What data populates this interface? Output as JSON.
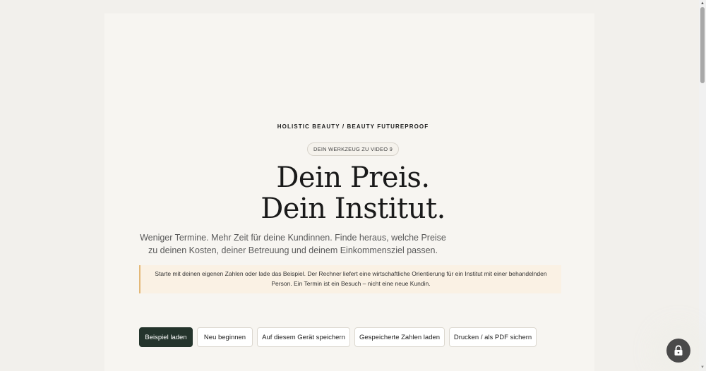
{
  "header": {
    "eyebrow": "HOLISTIC BEAUTY / BEAUTY FUTUREPROOF",
    "pill": "DEIN WERKZEUG ZU VIDEO 9",
    "headline_line1": "Dein Preis.",
    "headline_line2": "Dein Institut.",
    "intro": "Weniger Termine. Mehr Zeit für deine Kundinnen. Finde heraus, welche Preise zu deinen Kosten, deiner Betreuung und deinem Einkommensziel passen."
  },
  "notice": {
    "text": "Starte mit deinen eigenen Zahlen oder lade das Beispiel. Der Rechner liefert eine wirtschaftliche Orientierung für ein Institut mit einer behandelnden Person. Ein Termin ist ein Besuch – nicht eine neue Kundin."
  },
  "actions": {
    "load_example": "Beispiel laden",
    "restart": "Neu beginnen",
    "save_device": "Auf diesem Gerät speichern",
    "load_saved": "Gespeicherte Zahlen laden",
    "print_pdf": "Drucken / als PDF sichern"
  },
  "icons": {
    "floating": "lock-icon",
    "scroll_up": "arrow-up-icon",
    "scroll_down": "arrow-down-icon"
  },
  "colors": {
    "primary_button": "#24342c",
    "notice_background": "#faf1e4",
    "notice_border": "#e3b878",
    "page_background": "#f2f0ec",
    "card_background": "#f7f5f1"
  }
}
